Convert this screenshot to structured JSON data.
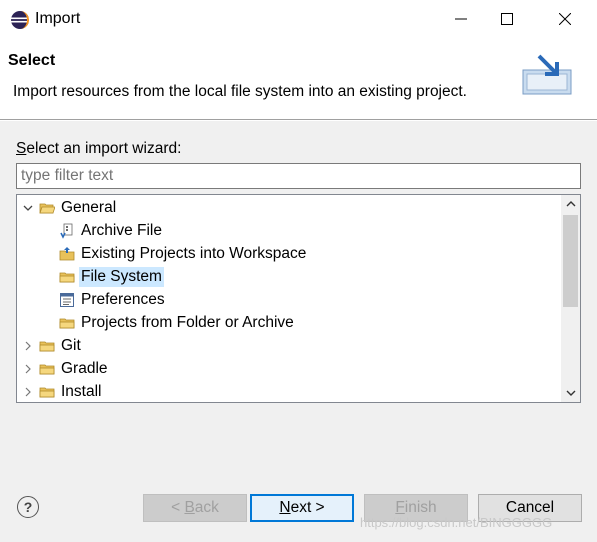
{
  "window": {
    "title": "Import"
  },
  "banner": {
    "title": "Select",
    "description": "Import resources from the local file system into an existing project."
  },
  "wizard": {
    "label_prefix": "S",
    "label_rest": "elect an import wizard:",
    "filter_placeholder": "type filter text",
    "filter_value": ""
  },
  "tree": {
    "items": [
      {
        "label": "General",
        "expanded": true,
        "icon": "folder-open-icon"
      },
      {
        "label": "Archive File",
        "icon": "archive-icon"
      },
      {
        "label": "Existing Projects into Workspace",
        "icon": "project-icon"
      },
      {
        "label": "File System",
        "icon": "folder-icon",
        "selected": true
      },
      {
        "label": "Preferences",
        "icon": "preferences-icon"
      },
      {
        "label": "Projects from Folder or Archive",
        "icon": "folder-icon"
      },
      {
        "label": "Git",
        "expanded": false,
        "icon": "folder-icon"
      },
      {
        "label": "Gradle",
        "expanded": false,
        "icon": "folder-icon"
      },
      {
        "label": "Install",
        "expanded": false,
        "icon": "folder-icon"
      }
    ]
  },
  "buttons": {
    "back_prefix": "< ",
    "back_mnemonic": "B",
    "back_rest": "ack",
    "next_mnemonic": "N",
    "next_rest": "ext >",
    "finish_mnemonic": "F",
    "finish_rest": "inish",
    "cancel": "Cancel",
    "help": "?"
  },
  "watermark": "https://blog.csdn.net/BINGGGGG",
  "colors": {
    "selection": "#cce8ff",
    "default_button_border": "#0078d7",
    "folder": "#e8c15a"
  }
}
